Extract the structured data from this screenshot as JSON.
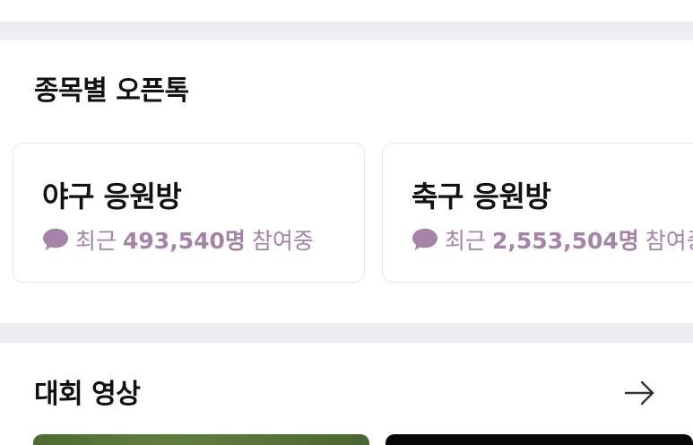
{
  "openchat_section": {
    "title": "종목별 오픈톡",
    "rooms": [
      {
        "name": "야구 응원방",
        "icon": "chat-bubble-icon",
        "prefix": "최근",
        "count": "493,540명",
        "suffix": "참여중"
      },
      {
        "name": "축구 응원방",
        "icon": "chat-bubble-icon",
        "prefix": "최근",
        "count": "2,553,504명",
        "suffix": "참여중"
      }
    ]
  },
  "video_section": {
    "title": "대회 영상",
    "more_icon": "arrow-right-icon"
  },
  "colors": {
    "divider": "#eceef1",
    "card_border": "#e5e6ea",
    "meta_accent": "#a583a8",
    "title_text": "#111111"
  }
}
